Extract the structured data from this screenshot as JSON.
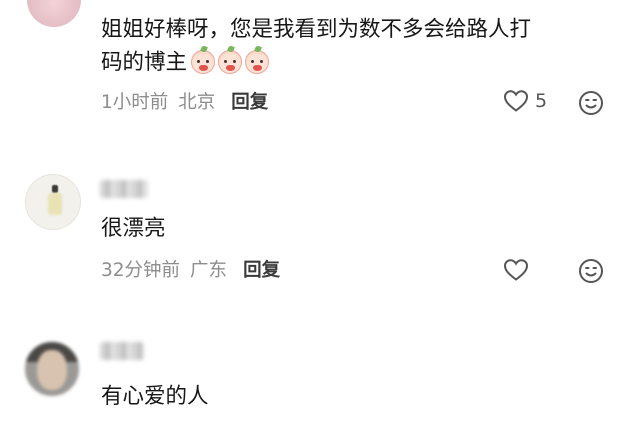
{
  "comments": [
    {
      "text_line1": "姐姐好棒呀，您是我看到为数不多会给路人打",
      "text_line2": "码的博主",
      "emoji_count": 3,
      "time": "1小时前",
      "location": "北京",
      "reply_label": "回复",
      "like_count": "5"
    },
    {
      "text_line1": "很漂亮",
      "time": "32分钟前",
      "location": "广东",
      "reply_label": "回复",
      "like_count": ""
    },
    {
      "text_line1": "有心爱的人"
    }
  ],
  "icons": {
    "like": "heart-icon",
    "react": "smiley-icon"
  },
  "colors": {
    "text": "#171717",
    "meta": "#8d8d8d",
    "reply": "#3a3a3a",
    "icon": "#555555"
  }
}
